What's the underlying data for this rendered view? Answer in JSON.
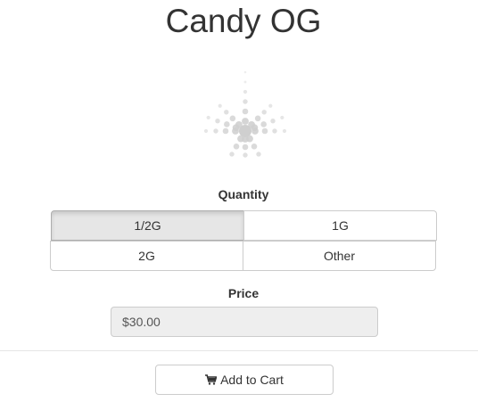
{
  "product": {
    "name": "Candy OG"
  },
  "logo": {
    "icon": "cannabis-leaf-icon",
    "color": "#cfcfcf"
  },
  "quantity": {
    "label": "Quantity",
    "options": [
      "1/2G",
      "1G",
      "2G",
      "Other"
    ],
    "selected": "1/2G"
  },
  "price": {
    "label": "Price",
    "value": "$30.00"
  },
  "cart": {
    "button_label": "Add to Cart",
    "icon": "shopping-cart-icon"
  },
  "colors": {
    "text": "#333333",
    "active_button": "#e6e6e6",
    "input_bg": "#eeeeee"
  }
}
